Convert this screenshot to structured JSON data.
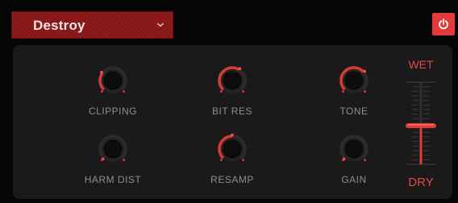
{
  "preset": {
    "value": "Destroy"
  },
  "knobs": [
    {
      "label": "CLIPPING",
      "value": 0.3
    },
    {
      "label": "BIT RES",
      "value": 0.62
    },
    {
      "label": "TONE",
      "value": 0.68
    },
    {
      "label": "HARM DIST",
      "value": 0.0
    },
    {
      "label": "RESAMP",
      "value": 0.5
    },
    {
      "label": "GAIN",
      "value": 0.0
    }
  ],
  "mix": {
    "top_label": "WET",
    "bottom_label": "DRY",
    "value": 0.47
  },
  "colors": {
    "accent": "#e43a3a",
    "knob_arc": "#d83b34",
    "header_background": "#8c1717",
    "panel": "#1a1a1a",
    "label": "#8e8e8e"
  },
  "icons": {
    "preset_dropdown": "chevron-down-icon",
    "power": "power-icon"
  }
}
